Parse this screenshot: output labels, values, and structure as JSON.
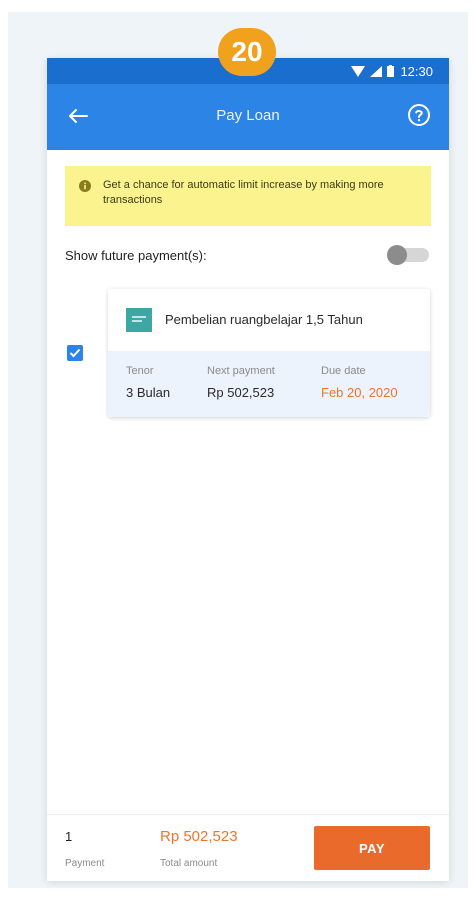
{
  "step_badge": "20",
  "status_bar": {
    "time": "12:30"
  },
  "app_bar": {
    "title": "Pay Loan",
    "back_icon": "arrow-left-icon",
    "help_icon": "help-circle-icon"
  },
  "banner": {
    "text": "Get a chance for automatic limit increase by making more transactions",
    "icon": "info-icon",
    "color": "#fbf38d"
  },
  "future_payments": {
    "label": "Show future payment(s):",
    "enabled": false
  },
  "loan": {
    "checked": true,
    "product": "Pembelian ruangbelajar 1,5 Tahun",
    "tenor_label": "Tenor",
    "tenor_value": "3 Bulan",
    "next_payment_label": "Next payment",
    "next_payment_value": "Rp 502,523",
    "due_label": "Due date",
    "due_value": "Feb 20, 2020"
  },
  "summary": {
    "count": "1",
    "count_label": "Payment",
    "total": "Rp 502,523",
    "total_label": "Total amount",
    "pay_label": "PAY"
  },
  "colors": {
    "primary": "#2b84e6",
    "accent": "#ea6a2c",
    "badge": "#f0a21e"
  }
}
